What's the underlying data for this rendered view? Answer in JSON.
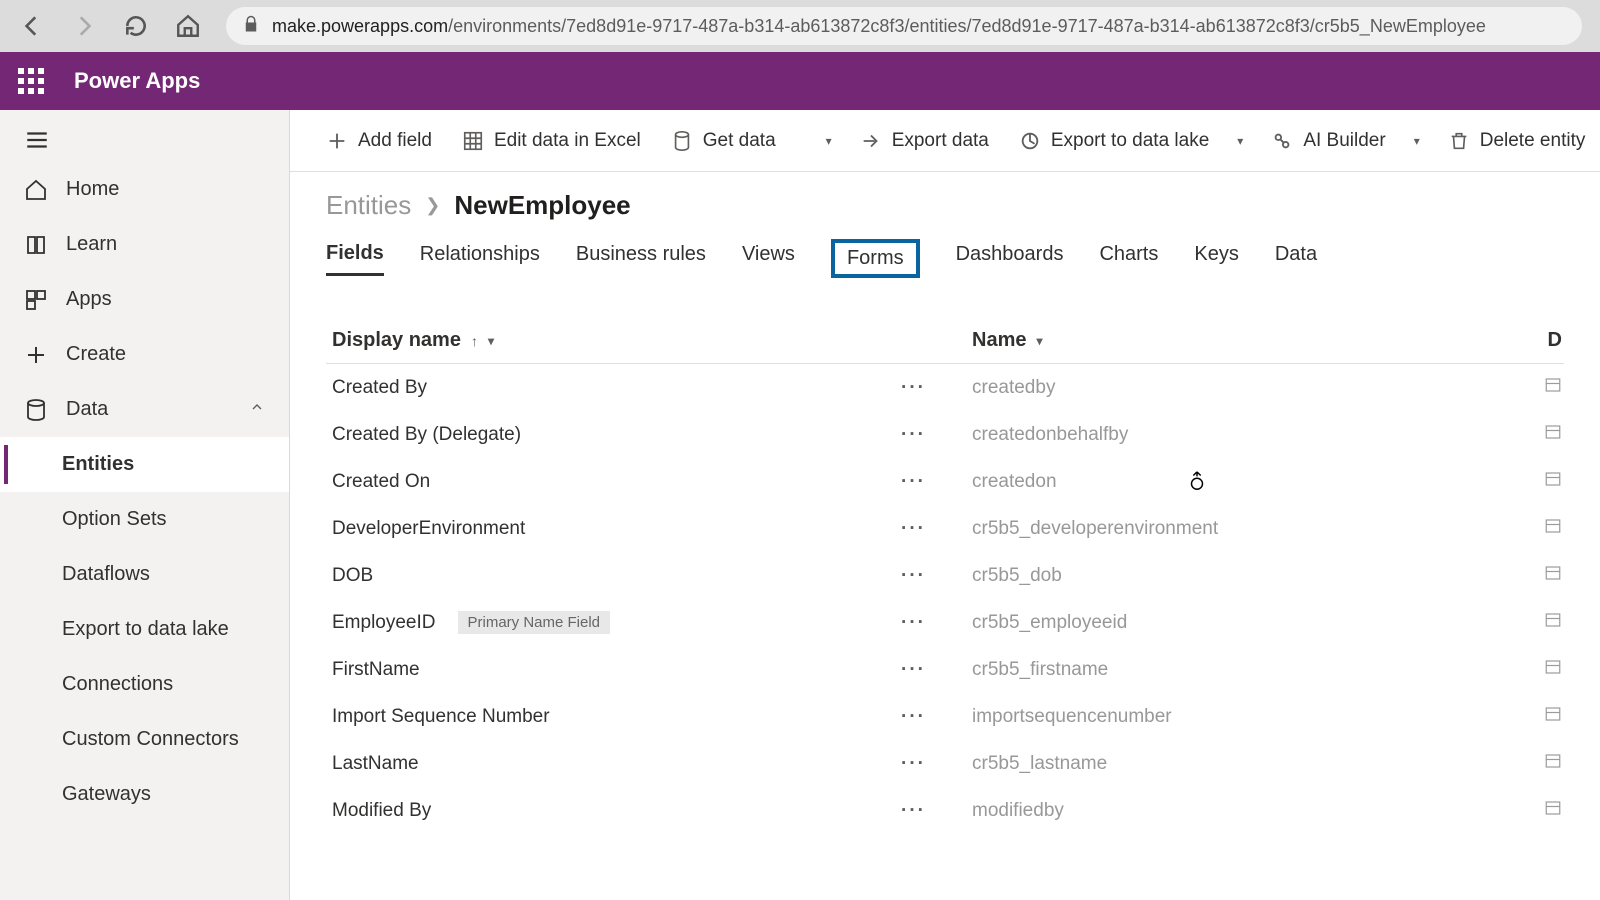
{
  "browser": {
    "url_host": "make.powerapps.com",
    "url_path": "/environments/7ed8d91e-9717-487a-b314-ab613872c8f3/entities/7ed8d91e-9717-487a-b314-ab613872c8f3/cr5b5_NewEmployee"
  },
  "app": {
    "title": "Power Apps"
  },
  "sidebar": {
    "items": [
      {
        "label": "Home"
      },
      {
        "label": "Learn"
      },
      {
        "label": "Apps"
      },
      {
        "label": "Create"
      },
      {
        "label": "Data"
      }
    ],
    "data_children": [
      {
        "label": "Entities"
      },
      {
        "label": "Option Sets"
      },
      {
        "label": "Dataflows"
      },
      {
        "label": "Export to data lake"
      },
      {
        "label": "Connections"
      },
      {
        "label": "Custom Connectors"
      },
      {
        "label": "Gateways"
      }
    ]
  },
  "commands": {
    "add_field": "Add field",
    "edit_excel": "Edit data in Excel",
    "get_data": "Get data",
    "export_data": "Export data",
    "export_lake": "Export to data lake",
    "ai_builder": "AI Builder",
    "delete_entity": "Delete entity"
  },
  "breadcrumb": {
    "root": "Entities",
    "leaf": "NewEmployee"
  },
  "tabs": [
    "Fields",
    "Relationships",
    "Business rules",
    "Views",
    "Forms",
    "Dashboards",
    "Charts",
    "Keys",
    "Data"
  ],
  "active_tab": "Fields",
  "highlighted_tab": "Forms",
  "columns": {
    "display": "Display name",
    "name": "Name",
    "third": "D"
  },
  "primary_badge": "Primary Name Field",
  "rows": [
    {
      "display": "Created By",
      "name": "createdby"
    },
    {
      "display": "Created By (Delegate)",
      "name": "createdonbehalfby"
    },
    {
      "display": "Created On",
      "name": "createdon"
    },
    {
      "display": "DeveloperEnvironment",
      "name": "cr5b5_developerenvironment"
    },
    {
      "display": "DOB",
      "name": "cr5b5_dob"
    },
    {
      "display": "EmployeeID",
      "name": "cr5b5_employeeid",
      "primary": true
    },
    {
      "display": "FirstName",
      "name": "cr5b5_firstname"
    },
    {
      "display": "Import Sequence Number",
      "name": "importsequencenumber"
    },
    {
      "display": "LastName",
      "name": "cr5b5_lastname"
    },
    {
      "display": "Modified By",
      "name": "modifiedby"
    }
  ]
}
